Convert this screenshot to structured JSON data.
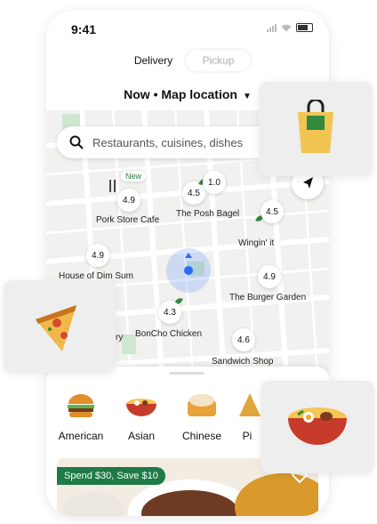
{
  "status_bar": {
    "time": "9:41"
  },
  "mode_toggle": {
    "delivery": "Delivery",
    "pickup": "Pickup"
  },
  "location": {
    "label": "Now • Map location"
  },
  "search": {
    "placeholder": "Restaurants, cuisines, dishes"
  },
  "map": {
    "pins": [
      {
        "rating": "4.9",
        "name": "Pork Store Cafe",
        "badge": "New"
      },
      {
        "rating": "4.5",
        "name": "The Posh Bagel"
      },
      {
        "rating": "1.0",
        "name": ""
      },
      {
        "rating": "4.5",
        "name": "Wingin' it"
      },
      {
        "rating": "4.9",
        "name": "House of Dim Sum"
      },
      {
        "rating": "4.9",
        "name": "The Burger Garden"
      },
      {
        "rating": "4.3",
        "name": "BonCho Chicken"
      },
      {
        "rating": "4.6",
        "name": "Sandwich Shop"
      }
    ],
    "partial_label": "ry"
  },
  "categories": [
    {
      "label": "American",
      "icon": "burger-icon"
    },
    {
      "label": "Asian",
      "icon": "noodle-bowl-icon"
    },
    {
      "label": "Chinese",
      "icon": "dumpling-icon"
    },
    {
      "label": "Pi",
      "icon": "pizza-icon"
    }
  ],
  "promo": {
    "badge": "Spend $30, Save $10"
  },
  "colors": {
    "accent_green": "#1e7a46",
    "map_bg": "#f1f1ef",
    "user_dot": "#2a6ef5"
  }
}
